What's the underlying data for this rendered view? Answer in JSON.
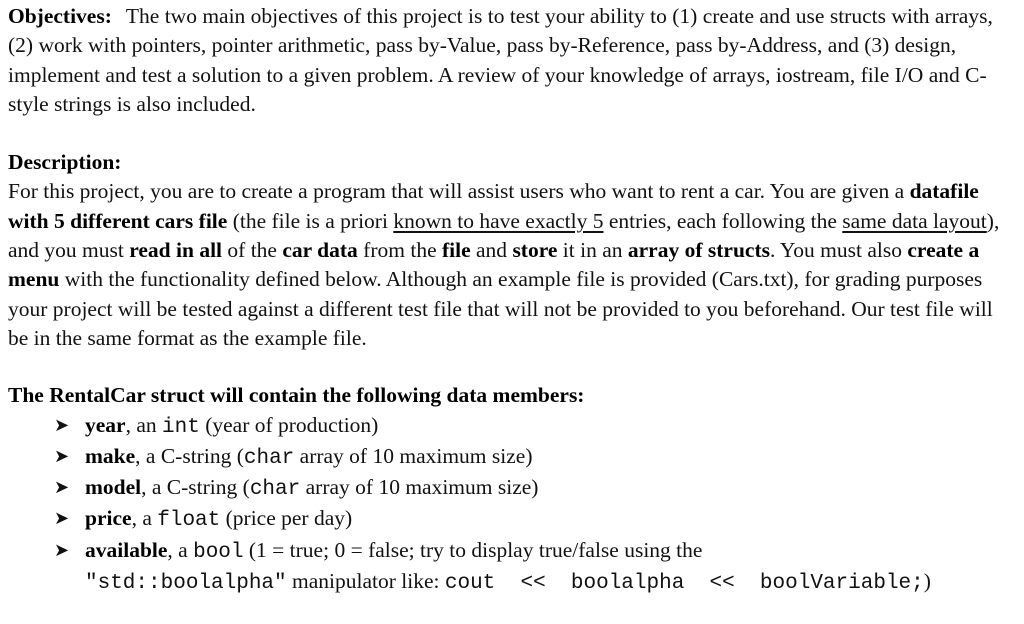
{
  "objectives": {
    "label": "Objectives:",
    "text": "The two main objectives of this project is to test your ability to (1) create and use structs with arrays, (2) work with pointers, pointer arithmetic, pass by-Value, pass by-Reference, pass by-Address, and (3) design, implement and test a solution to a given problem. A review of your knowledge of arrays, iostream, file I/O and C-style strings is also included."
  },
  "description": {
    "label": "Description:",
    "segments": [
      {
        "t": "For this project, you are to create a program that will assist users who want to rent a car. You are given a ",
        "s": "normal"
      },
      {
        "t": "datafile with 5 different cars file",
        "s": "bold"
      },
      {
        "t": " (the file is a priori ",
        "s": "normal"
      },
      {
        "t": "known to have exactly 5",
        "s": "underline"
      },
      {
        "t": " entries, each following the ",
        "s": "normal"
      },
      {
        "t": "same data layout",
        "s": "underline"
      },
      {
        "t": "), and you must ",
        "s": "normal"
      },
      {
        "t": "read in all",
        "s": "bold"
      },
      {
        "t": " of the ",
        "s": "normal"
      },
      {
        "t": "car data",
        "s": "bold"
      },
      {
        "t": " from the ",
        "s": "normal"
      },
      {
        "t": "file",
        "s": "bold"
      },
      {
        "t": " and ",
        "s": "normal"
      },
      {
        "t": "store",
        "s": "bold"
      },
      {
        "t": " it in an ",
        "s": "normal"
      },
      {
        "t": "array of structs",
        "s": "bold"
      },
      {
        "t": ". You must also ",
        "s": "normal"
      },
      {
        "t": "create a menu",
        "s": "bold"
      },
      {
        "t": " with the functionality defined below. Although an example file is provided (Cars.txt), for grading purposes your project will be tested against a different test file that will not be provided to you beforehand. Our test file will be in the same format as the example file.",
        "s": "normal"
      }
    ]
  },
  "struct_section": {
    "heading": "The RentalCar struct will contain the following data members:",
    "bullet_icon": "arrowhead-bullet",
    "members": [
      {
        "name": "year",
        "pre": ", an ",
        "type": "int",
        "post": " (year of production)"
      },
      {
        "name": "make",
        "pre": ", a C-string (",
        "type": "char",
        "post": " array of 10 maximum size)"
      },
      {
        "name": "model",
        "pre": ", a C-string (",
        "type": "char",
        "post": " array of 10 maximum size)"
      },
      {
        "name": "price",
        "pre": ", a ",
        "type": "float",
        "post": " (price per day)"
      },
      {
        "name": "available",
        "pre": ", a ",
        "type": "bool",
        "post": " (1 = true; 0 = false; try to display true/false using the",
        "line2_code1": "\"std::boolalpha\"",
        "line2_text": " manipulator like: ",
        "line2_code2": "cout << boolalpha << boolVariable;",
        "line2_end": ")"
      }
    ]
  }
}
